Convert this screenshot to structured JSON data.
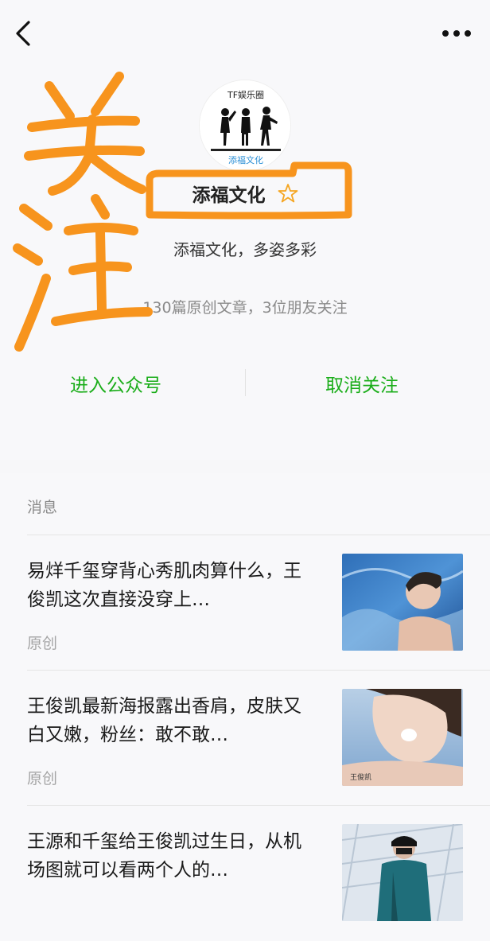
{
  "header": {
    "back_icon": "chevron-left-icon",
    "more_icon": "more-dots-icon"
  },
  "account": {
    "avatar_text_top": "TF娱乐圈",
    "avatar_text_bottom": "添福文化",
    "name": "添福文化",
    "star_icon": "star-outline-icon",
    "description": "添福文化，多姿多彩",
    "stats": "130篇原创文章，3位朋友关注",
    "enter_label": "进入公众号",
    "unfollow_label": "取消关注"
  },
  "annotation": {
    "text": "关注",
    "color": "#f7941d"
  },
  "messages": {
    "section_title": "消息",
    "articles": [
      {
        "title": "易烊千玺穿背心秀肌肉算什么，王俊凯这次直接没穿上…",
        "tag": "原创"
      },
      {
        "title": "王俊凯最新海报露出香肩，皮肤又白又嫩，粉丝：敢不敢…",
        "tag": "原创",
        "thumb_caption": "王俊凯"
      },
      {
        "title": "王源和千玺给王俊凯过生日，从机场图就可以看两个人的…",
        "tag": ""
      }
    ]
  },
  "colors": {
    "accent_green": "#1aad19",
    "star": "#f5a623",
    "annotation_orange": "#f7941d"
  }
}
